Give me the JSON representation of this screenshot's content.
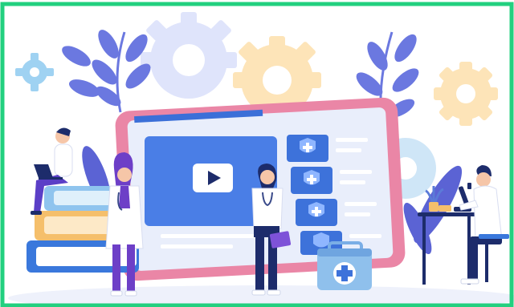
{
  "scene": {
    "alt": "",
    "colors": {
      "frame": "#22d07f",
      "tablet_border": "#ea86a6",
      "tablet_screen": "#e9eefb",
      "screen_header": "#3b6fd8",
      "video_panel": "#4a7ee6",
      "shield_card": "#3d72da",
      "gear_light": "#dfe4fb",
      "gear_orange": "#fde4b8",
      "gear_blue": "#bfe0f5",
      "leaf": "#6b78e0",
      "book_blue": "#3a78dc",
      "book_orange": "#f5bf6b",
      "book_lightblue": "#8fc4ee",
      "scrub_purple": "#6d3fc7",
      "coat_white": "#ffffff",
      "kit_blue": "#8fc0ec"
    },
    "icons": [
      "play-icon",
      "shield-cross-icon",
      "gear-icon",
      "microscope-icon",
      "laptop-icon",
      "first-aid-kit-icon",
      "leaf-icon"
    ]
  }
}
